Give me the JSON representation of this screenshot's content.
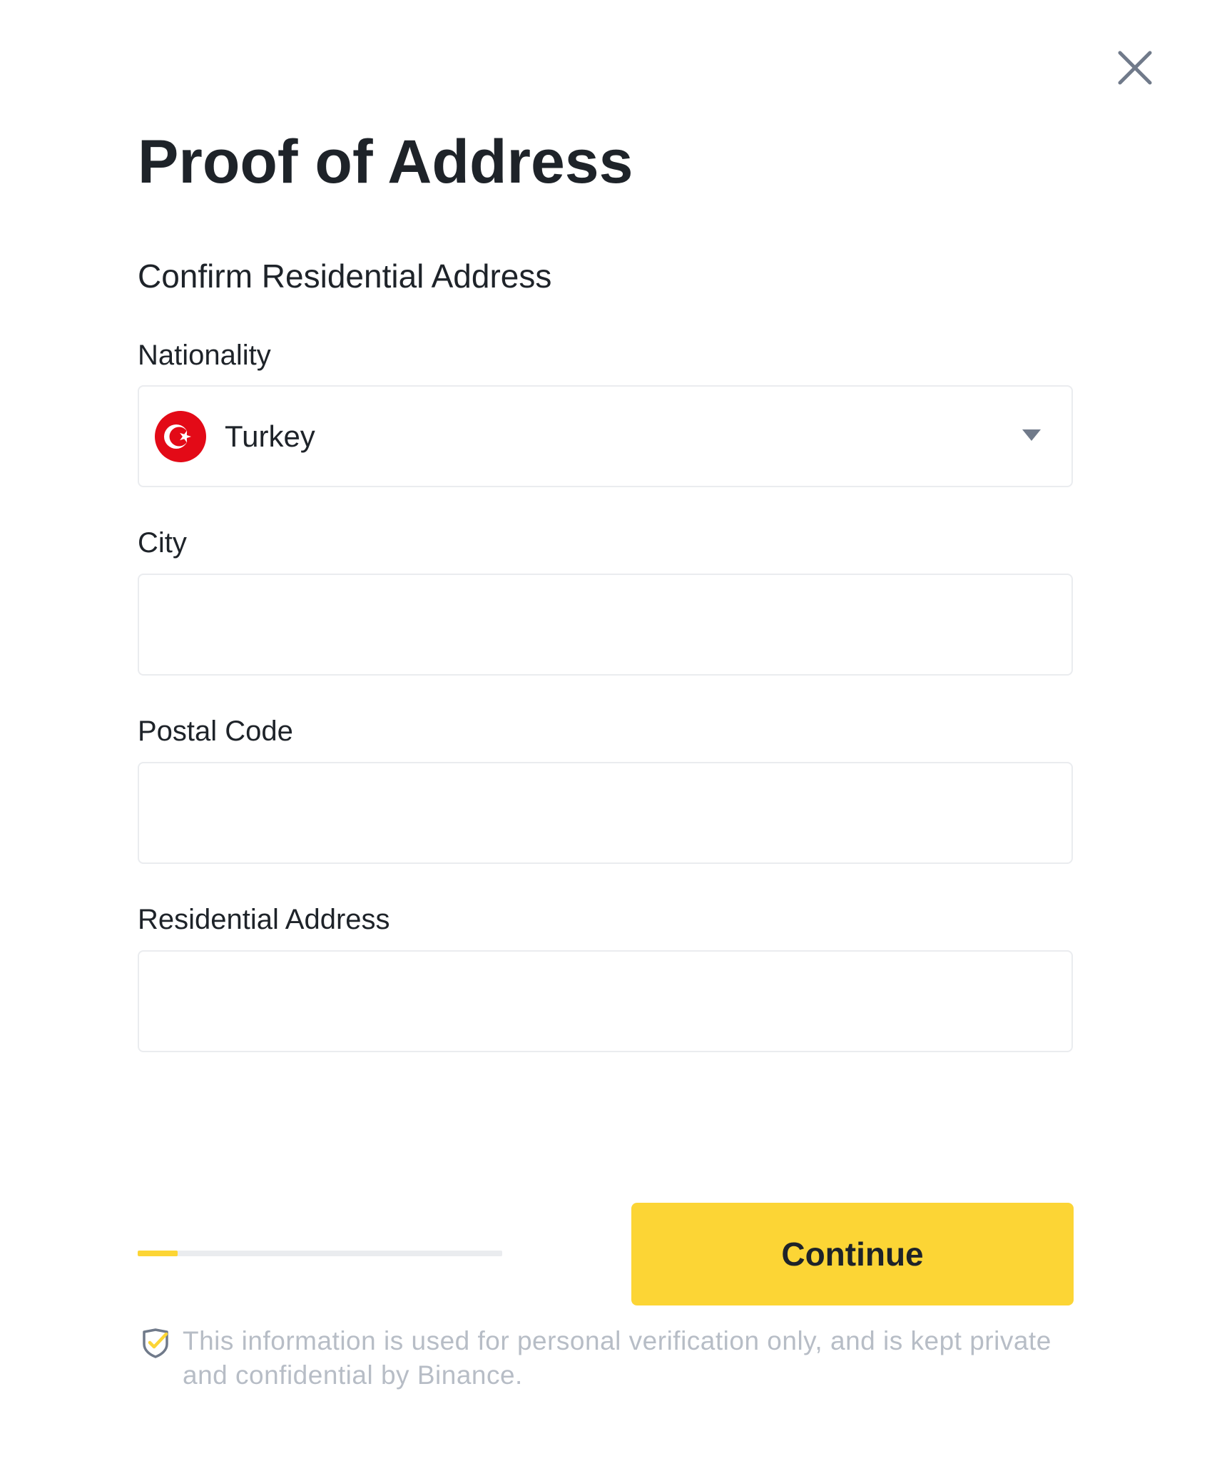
{
  "dialog": {
    "title": "Proof of Address",
    "subtitle": "Confirm Residential Address",
    "close_icon": "close-icon"
  },
  "fields": {
    "nationality": {
      "label": "Nationality",
      "value": "Turkey",
      "flag_icon": "turkey-flag-icon",
      "caret_icon": "caret-down-icon"
    },
    "city": {
      "label": "City",
      "value": ""
    },
    "postal_code": {
      "label": "Postal Code",
      "value": ""
    },
    "residential_address": {
      "label": "Residential Address",
      "value": ""
    }
  },
  "progress": {
    "fraction": 0.11
  },
  "actions": {
    "continue_label": "Continue"
  },
  "notice": {
    "icon": "shield-check-icon",
    "text": "This information is used for personal verification only, and is kept private and confidential by Binance."
  },
  "colors": {
    "accent": "#fcd535",
    "text_primary": "#1e2329",
    "text_muted": "#b7bdc6",
    "border": "#eaecef",
    "flag_red": "#e30a17",
    "icon_gray": "#707a8a"
  }
}
